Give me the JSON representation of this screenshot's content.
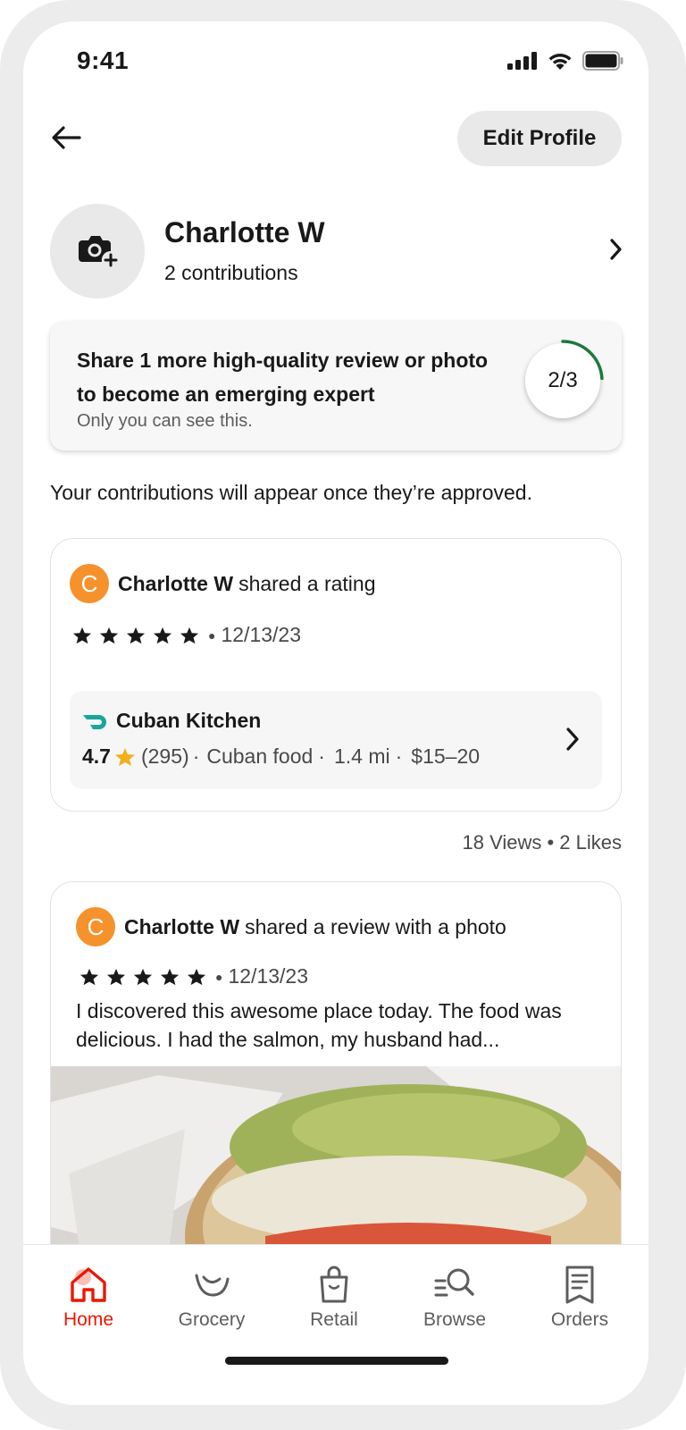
{
  "status_bar": {
    "time": "9:41",
    "icons": [
      "cellular-signal-icon",
      "wifi-icon",
      "battery-icon"
    ]
  },
  "header": {
    "back_icon": "arrow-left-icon",
    "edit_profile_label": "Edit Profile"
  },
  "profile": {
    "name": "Charlotte W",
    "contributions": "2  contributions",
    "avatar_icon": "add-photo-icon"
  },
  "progress_card": {
    "title": "Share 1 more high-quality review or photo to become an emerging expert",
    "note": "Only you can see this.",
    "count": "2/3",
    "progress": 0.667,
    "ring_color": "#1a7a3b"
  },
  "approval_note": "Your contributions will appear once they’re approved.",
  "contributions": [
    {
      "avatar_letter": "C",
      "author": "Charlotte W",
      "action": "shared a rating",
      "stars": 5,
      "date": "12/13/23",
      "store": {
        "name": "Cuban Kitchen",
        "rating": "4.7",
        "count": "(295)",
        "sep1": "·",
        "cuisine": "Cuban food",
        "sep2": "·",
        "distance": "1.4 mi",
        "sep3": "·",
        "price": "$15–20"
      },
      "stats": "18 Views • 2 Likes"
    },
    {
      "avatar_letter": "C",
      "author": "Charlotte W",
      "action": "shared a review with a photo",
      "stars": 5,
      "date": "12/13/23",
      "text": "I discovered this awesome place today. The food was delicious. I had the salmon, my husband had..."
    }
  ],
  "bottom_nav": [
    {
      "label": "Home",
      "icon": "home-icon",
      "active": true
    },
    {
      "label": "Grocery",
      "icon": "grocery-icon",
      "active": false
    },
    {
      "label": "Retail",
      "icon": "shopping-bag-icon",
      "active": false
    },
    {
      "label": "Browse",
      "icon": "browse-search-icon",
      "active": false
    },
    {
      "label": "Orders",
      "icon": "receipt-icon",
      "active": false
    }
  ],
  "colors": {
    "accent": "#eb1700",
    "avatar": "#f5922c",
    "star_gold": "#f2b01e",
    "brand_teal": "#1aa69a"
  }
}
